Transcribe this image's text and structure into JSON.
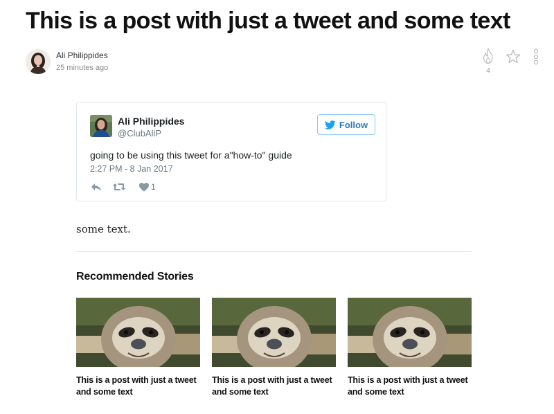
{
  "post": {
    "title": "This is a post with just a tweet and some text",
    "author_name": "Ali Philippides",
    "time": "25 minutes ago",
    "flame_count": "4",
    "body_text": "some text."
  },
  "icons": {
    "flame": "flame-icon",
    "star": "star-icon",
    "more": "more-vertical-icon",
    "reply": "reply-icon",
    "retweet": "retweet-icon",
    "like": "heart-icon",
    "twitter": "twitter-bird-icon"
  },
  "tweet": {
    "name": "Ali Philippides",
    "handle": "@ClubAliP",
    "follow_label": "Follow",
    "text": "going to be using this tweet for a\"how-to\" guide",
    "timestamp": "2:27 PM - 8 Jan 2017",
    "like_count": "1"
  },
  "recommended": {
    "heading": "Recommended Stories",
    "stories": [
      {
        "title": "This is a post with just a tweet and some text"
      },
      {
        "title": "This is a post with just a tweet and some text"
      },
      {
        "title": "This is a post with just a tweet and some text"
      }
    ]
  },
  "colors": {
    "twitter_blue": "#1da1f2",
    "follow_text": "#2b7bb9",
    "muted": "#697882"
  }
}
